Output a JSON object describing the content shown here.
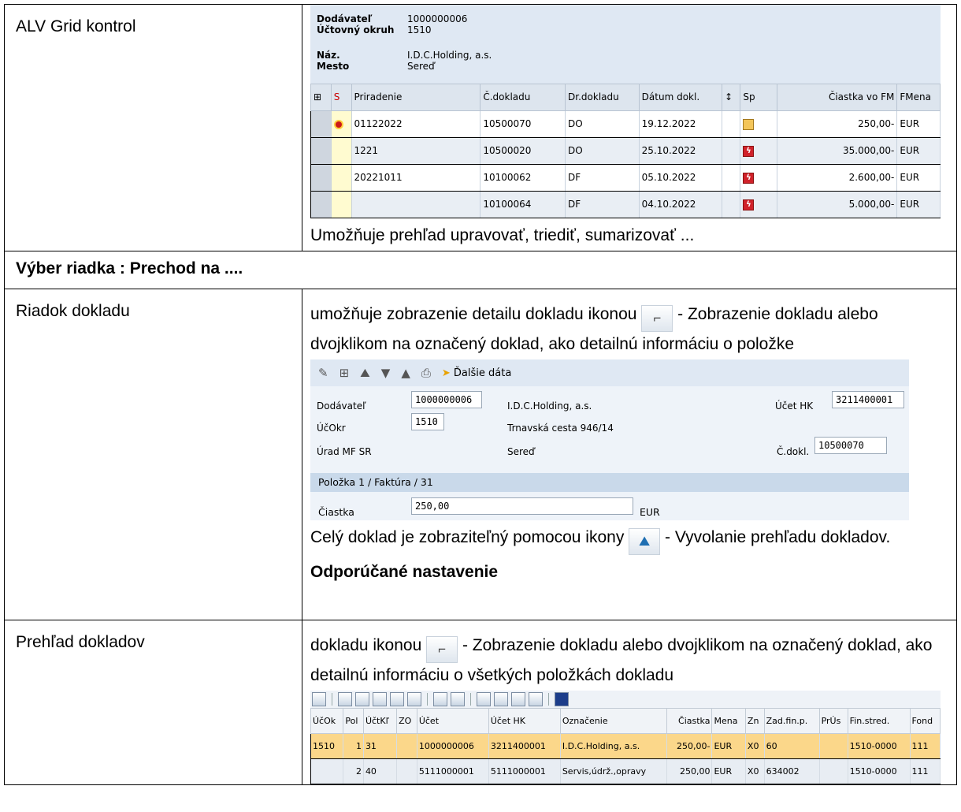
{
  "rows": [
    {
      "label": "ALV Grid kontrol"
    },
    {
      "label": "Riadok dokladu"
    },
    {
      "label": "Prehľad dokladov"
    }
  ],
  "section_heading": "Výber riadka : Prechod na ....",
  "alv": {
    "header": [
      {
        "key": "Dodávateľ",
        "value": "1000000006"
      },
      {
        "key": "Účtovný okruh",
        "value": "1510"
      },
      {
        "key": "Náz.",
        "value": "I.D.C.Holding, a.s."
      },
      {
        "key": "Mesto",
        "value": "Sereď"
      }
    ],
    "columns": [
      "S",
      "Priradenie",
      "Č.dokladu",
      "Dr.dokladu",
      "Dátum dokl.",
      "Sp",
      "Čiastka vo FM",
      "FMena"
    ],
    "rows": [
      {
        "assign": "01122022",
        "doc": "10500070",
        "type": "DO",
        "date": "19.12.2022",
        "amount": "250,00-",
        "cur": "EUR"
      },
      {
        "assign": "1221",
        "doc": "10500020",
        "type": "DO",
        "date": "25.10.2022",
        "amount": "35.000,00-",
        "cur": "EUR"
      },
      {
        "assign": "20221011",
        "doc": "10100062",
        "type": "DF",
        "date": "05.10.2022",
        "amount": "2.600,00-",
        "cur": "EUR"
      },
      {
        "assign": "",
        "doc": "10100064",
        "type": "DF",
        "date": "04.10.2022",
        "amount": "5.000,00-",
        "cur": "EUR"
      }
    ],
    "caption": "Umožňuje prehľad upravovať, triediť, sumarizovať ..."
  },
  "riadok": {
    "p1_a": "umožňuje zobrazenie detailu dokladu ikonou",
    "p1_b": " - Zobrazenie dokladu alebo dvojklikom na označený doklad, ako detailnú informáciu o položke",
    "toolbar_label": "Ďalšie dáta",
    "vendor_label": "Dodávateľ",
    "vendor_value": "1000000006",
    "vendor_name": "I.D.C.Holding, a.s.",
    "gl_label": "Účet HK",
    "gl_value": "3211400001",
    "cc_label": "ÚčOkr",
    "cc_value": "1510",
    "street": "Trnavská cesta 946/14",
    "office": "Úrad MF SR",
    "city": "Sereď",
    "docno_label": "Č.dokl.",
    "docno_value": "10500070",
    "item_line": "Položka 1 / Faktúra / 31",
    "amount_label": "Čiastka",
    "amount_value": "250,00",
    "amount_cur": "EUR",
    "p2_a": "Celý doklad je zobraziteľný pomocou ikony",
    "p2_b": " - Vyvolanie prehľadu dokladov.",
    "recommend": "Odporúčané nastavenie"
  },
  "prehlad": {
    "p_a": "dokladu ikonou",
    "p_b": " - Zobrazenie dokladu alebo dvojklikom na označený doklad, ako detailnú informáciu o všetkých položkách dokladu",
    "columns": [
      "ÚčOk",
      "Pol",
      "ÚčtKľ",
      "ZO",
      "Účet",
      "Účet HK",
      "Označenie",
      "Čiastka",
      "Mena",
      "Zn",
      "Zad.fin.p.",
      "PrÚs",
      "Fin.stred.",
      "Fond"
    ],
    "rows": [
      [
        "1510",
        "1",
        "31",
        "",
        "1000000006",
        "3211400001",
        "I.D.C.Holding, a.s.",
        "250,00-",
        "EUR",
        "X0",
        "60",
        "",
        "1510-0000",
        "111"
      ],
      [
        "",
        "2",
        "40",
        "",
        "5111000001",
        "5111000001",
        "Servis,údrž.,opravy",
        "250,00",
        "EUR",
        "X0",
        "634002",
        "",
        "1510-0000",
        "111"
      ]
    ]
  },
  "icons": {
    "display": "glasses-icon",
    "overview": "mountain-person-icon"
  }
}
